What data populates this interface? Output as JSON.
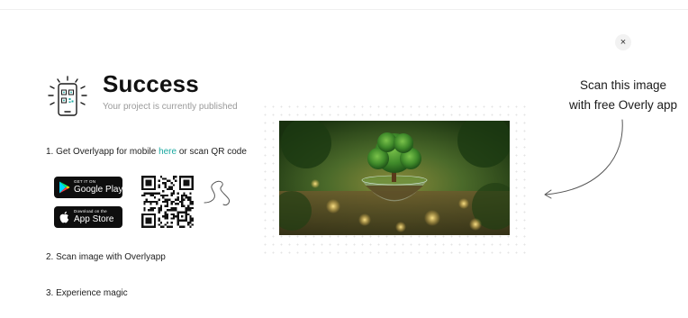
{
  "modal": {
    "close_symbol": "×",
    "title": "Success",
    "subtitle": "Your project is currently published"
  },
  "steps": {
    "step1_prefix": "1. Get Overlyapp for mobile ",
    "step1_link": "here",
    "step1_suffix": " or scan QR code",
    "step2": "2. Scan image with Overlyapp",
    "step3": "3. Experience magic"
  },
  "badges": {
    "google_small": "GET IT ON",
    "google_big": "Google Play",
    "apple_small": "Download on the",
    "apple_big": "App Store"
  },
  "hint": {
    "line1": "Scan this image",
    "line2": "with free Overly app"
  },
  "icons": [
    "close-icon",
    "phone-qr-icon",
    "google-play-icon",
    "apple-icon",
    "qr-code",
    "squiggle-arrow",
    "curved-arrow-icon"
  ],
  "colors": {
    "accent_link": "#1aa8a0",
    "badge_bg": "#0e0e0e",
    "title": "#111111",
    "subtitle": "#9a9a9a"
  }
}
